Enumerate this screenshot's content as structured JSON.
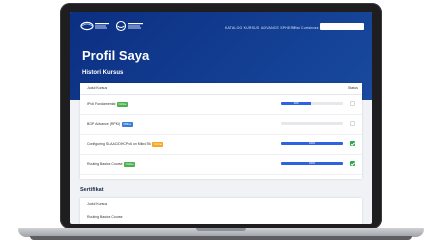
{
  "header": {
    "nav": [
      "KATALOG KURSUS",
      "ADVANCE SPHERE",
      "Hai Curtsboss ▾"
    ],
    "search_placeholder": "",
    "page_title": "Profil Saya"
  },
  "history": {
    "title": "Histori Kursus",
    "col_name": "Judul Kursus",
    "col_status": "Status",
    "rows": [
      {
        "name": "IPv6 Fundamental",
        "badge": "Online",
        "badge_color": "#4caf50",
        "progress": 0.49,
        "progress_label": "49%",
        "done": false
      },
      {
        "name": "BGP Advance (RPKI)",
        "badge": "Offline",
        "badge_color": "#3a7bd5",
        "progress": 0,
        "progress_label": "",
        "done": false
      },
      {
        "name": "Configuring SLAAC/DHCPv6 on MikroTik",
        "badge": "Online",
        "badge_color": "#f5a623",
        "progress": 1.0,
        "progress_label": "100%",
        "done": true
      },
      {
        "name": "Routing Basics Course",
        "badge": "Online",
        "badge_color": "#4caf50",
        "progress": 1.0,
        "progress_label": "100%",
        "done": true
      }
    ]
  },
  "certificate": {
    "title": "Sertifikat",
    "col_name": "Judul Kursus",
    "first_row": "Routing Basics Course"
  }
}
